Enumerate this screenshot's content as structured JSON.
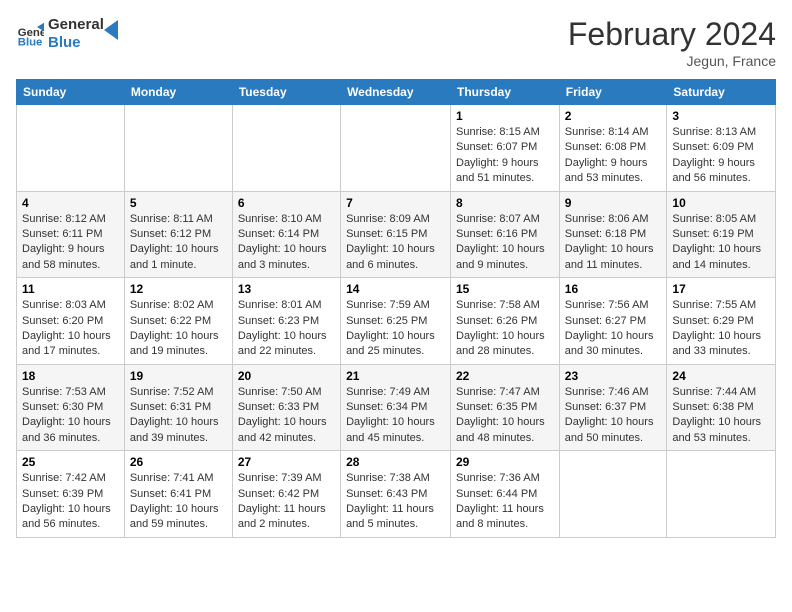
{
  "logo": {
    "line1": "General",
    "line2": "Blue"
  },
  "header": {
    "title": "February 2024",
    "subtitle": "Jegun, France"
  },
  "weekdays": [
    "Sunday",
    "Monday",
    "Tuesday",
    "Wednesday",
    "Thursday",
    "Friday",
    "Saturday"
  ],
  "weeks": [
    [
      {
        "day": "",
        "info": ""
      },
      {
        "day": "",
        "info": ""
      },
      {
        "day": "",
        "info": ""
      },
      {
        "day": "",
        "info": ""
      },
      {
        "day": "1",
        "info": "Sunrise: 8:15 AM\nSunset: 6:07 PM\nDaylight: 9 hours\nand 51 minutes."
      },
      {
        "day": "2",
        "info": "Sunrise: 8:14 AM\nSunset: 6:08 PM\nDaylight: 9 hours\nand 53 minutes."
      },
      {
        "day": "3",
        "info": "Sunrise: 8:13 AM\nSunset: 6:09 PM\nDaylight: 9 hours\nand 56 minutes."
      }
    ],
    [
      {
        "day": "4",
        "info": "Sunrise: 8:12 AM\nSunset: 6:11 PM\nDaylight: 9 hours\nand 58 minutes."
      },
      {
        "day": "5",
        "info": "Sunrise: 8:11 AM\nSunset: 6:12 PM\nDaylight: 10 hours\nand 1 minute."
      },
      {
        "day": "6",
        "info": "Sunrise: 8:10 AM\nSunset: 6:14 PM\nDaylight: 10 hours\nand 3 minutes."
      },
      {
        "day": "7",
        "info": "Sunrise: 8:09 AM\nSunset: 6:15 PM\nDaylight: 10 hours\nand 6 minutes."
      },
      {
        "day": "8",
        "info": "Sunrise: 8:07 AM\nSunset: 6:16 PM\nDaylight: 10 hours\nand 9 minutes."
      },
      {
        "day": "9",
        "info": "Sunrise: 8:06 AM\nSunset: 6:18 PM\nDaylight: 10 hours\nand 11 minutes."
      },
      {
        "day": "10",
        "info": "Sunrise: 8:05 AM\nSunset: 6:19 PM\nDaylight: 10 hours\nand 14 minutes."
      }
    ],
    [
      {
        "day": "11",
        "info": "Sunrise: 8:03 AM\nSunset: 6:20 PM\nDaylight: 10 hours\nand 17 minutes."
      },
      {
        "day": "12",
        "info": "Sunrise: 8:02 AM\nSunset: 6:22 PM\nDaylight: 10 hours\nand 19 minutes."
      },
      {
        "day": "13",
        "info": "Sunrise: 8:01 AM\nSunset: 6:23 PM\nDaylight: 10 hours\nand 22 minutes."
      },
      {
        "day": "14",
        "info": "Sunrise: 7:59 AM\nSunset: 6:25 PM\nDaylight: 10 hours\nand 25 minutes."
      },
      {
        "day": "15",
        "info": "Sunrise: 7:58 AM\nSunset: 6:26 PM\nDaylight: 10 hours\nand 28 minutes."
      },
      {
        "day": "16",
        "info": "Sunrise: 7:56 AM\nSunset: 6:27 PM\nDaylight: 10 hours\nand 30 minutes."
      },
      {
        "day": "17",
        "info": "Sunrise: 7:55 AM\nSunset: 6:29 PM\nDaylight: 10 hours\nand 33 minutes."
      }
    ],
    [
      {
        "day": "18",
        "info": "Sunrise: 7:53 AM\nSunset: 6:30 PM\nDaylight: 10 hours\nand 36 minutes."
      },
      {
        "day": "19",
        "info": "Sunrise: 7:52 AM\nSunset: 6:31 PM\nDaylight: 10 hours\nand 39 minutes."
      },
      {
        "day": "20",
        "info": "Sunrise: 7:50 AM\nSunset: 6:33 PM\nDaylight: 10 hours\nand 42 minutes."
      },
      {
        "day": "21",
        "info": "Sunrise: 7:49 AM\nSunset: 6:34 PM\nDaylight: 10 hours\nand 45 minutes."
      },
      {
        "day": "22",
        "info": "Sunrise: 7:47 AM\nSunset: 6:35 PM\nDaylight: 10 hours\nand 48 minutes."
      },
      {
        "day": "23",
        "info": "Sunrise: 7:46 AM\nSunset: 6:37 PM\nDaylight: 10 hours\nand 50 minutes."
      },
      {
        "day": "24",
        "info": "Sunrise: 7:44 AM\nSunset: 6:38 PM\nDaylight: 10 hours\nand 53 minutes."
      }
    ],
    [
      {
        "day": "25",
        "info": "Sunrise: 7:42 AM\nSunset: 6:39 PM\nDaylight: 10 hours\nand 56 minutes."
      },
      {
        "day": "26",
        "info": "Sunrise: 7:41 AM\nSunset: 6:41 PM\nDaylight: 10 hours\nand 59 minutes."
      },
      {
        "day": "27",
        "info": "Sunrise: 7:39 AM\nSunset: 6:42 PM\nDaylight: 11 hours\nand 2 minutes."
      },
      {
        "day": "28",
        "info": "Sunrise: 7:38 AM\nSunset: 6:43 PM\nDaylight: 11 hours\nand 5 minutes."
      },
      {
        "day": "29",
        "info": "Sunrise: 7:36 AM\nSunset: 6:44 PM\nDaylight: 11 hours\nand 8 minutes."
      },
      {
        "day": "",
        "info": ""
      },
      {
        "day": "",
        "info": ""
      }
    ]
  ]
}
